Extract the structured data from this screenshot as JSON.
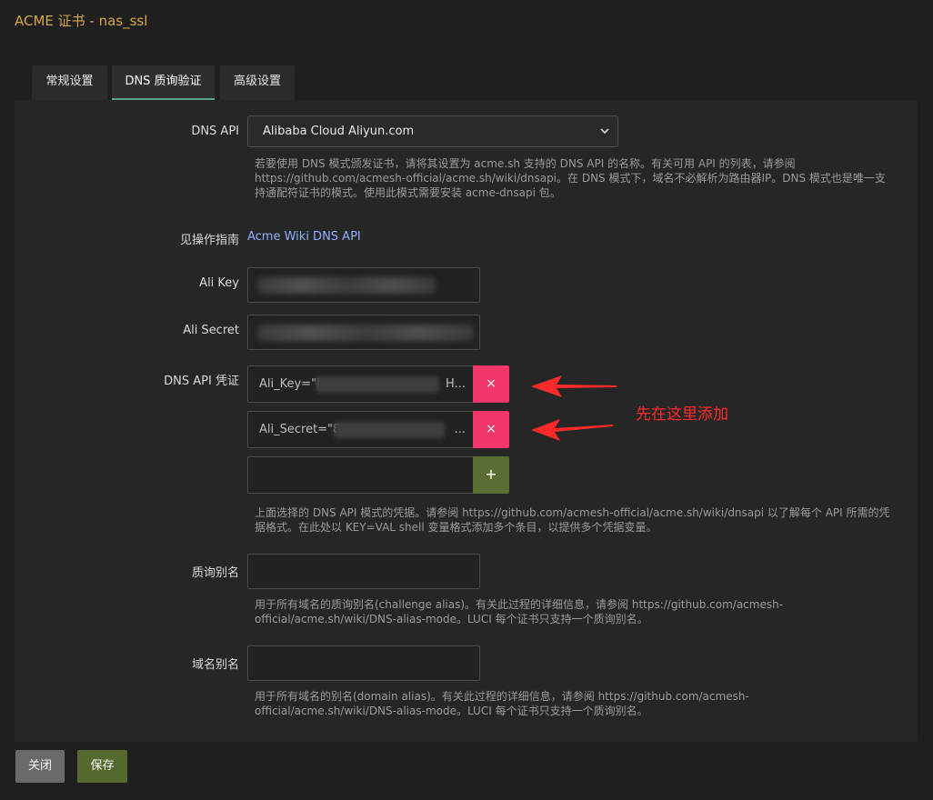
{
  "window": {
    "title": "ACME 证书 - nas_ssl"
  },
  "tabs": [
    {
      "label": "常规设置"
    },
    {
      "label": "DNS 质询验证"
    },
    {
      "label": "高级设置"
    }
  ],
  "dns_api": {
    "label": "DNS API",
    "selected": "Alibaba Cloud Aliyun.com",
    "help": [
      "若要使用 DNS 模式颁发证书，请将其设置为 acme.sh 支持的 DNS API 的名称。有关可用 API 的列表，请参阅",
      "https://github.com/acmesh-official/acme.sh/wiki/dnsapi。在 DNS 模式下，域名不必解析为路由器IP。DNS 模式也是唯一支",
      "持通配符证书的模式。使用此模式需要安装 acme-dnsapi 包。"
    ]
  },
  "guide": {
    "label": "见操作指南",
    "link": "Acme Wiki DNS API"
  },
  "ali_key": {
    "label": "Ali Key"
  },
  "ali_secret": {
    "label": "Ali Secret"
  },
  "credentials": {
    "label": "DNS API 凭证",
    "items": [
      {
        "prefix": "Ali_Key=\"l",
        "suffix": "H..."
      },
      {
        "prefix": "Ali_Secret=\"8",
        "suffix": "..."
      }
    ],
    "remove_symbol": "×",
    "add_symbol": "+",
    "help": [
      "上面选择的 DNS API 模式的凭据。请参阅 https://github.com/acmesh-official/acme.sh/wiki/dnsapi 以了解每个 API 所需的凭",
      "据格式。在此处以 KEY=VAL shell 变量格式添加多个条目，以提供多个凭据变量。"
    ]
  },
  "challenge_alias": {
    "label": "质询别名",
    "help": [
      "用于所有域名的质询别名(challenge alias)。有关此过程的详细信息，请参阅 https://github.com/acmesh-",
      "official/acme.sh/wiki/DNS-alias-mode。LUCI 每个证书只支持一个质询别名。"
    ]
  },
  "domain_alias": {
    "label": "域名别名",
    "help": [
      "用于所有域名的别名(domain alias)。有关此过程的详细信息，请参阅 https://github.com/acmesh-",
      "official/acme.sh/wiki/DNS-alias-mode。LUCI 每个证书只支持一个质询别名。"
    ]
  },
  "annotation": {
    "text": "先在这里添加",
    "color": "#ff2b2b"
  },
  "footer": {
    "close_label": "关闭",
    "save_label": "保存"
  },
  "colors": {
    "accent": "#5aa48e",
    "title": "#d8a544",
    "danger": "#f2356b",
    "success": "#566a2f",
    "link": "#8fb0ff"
  }
}
